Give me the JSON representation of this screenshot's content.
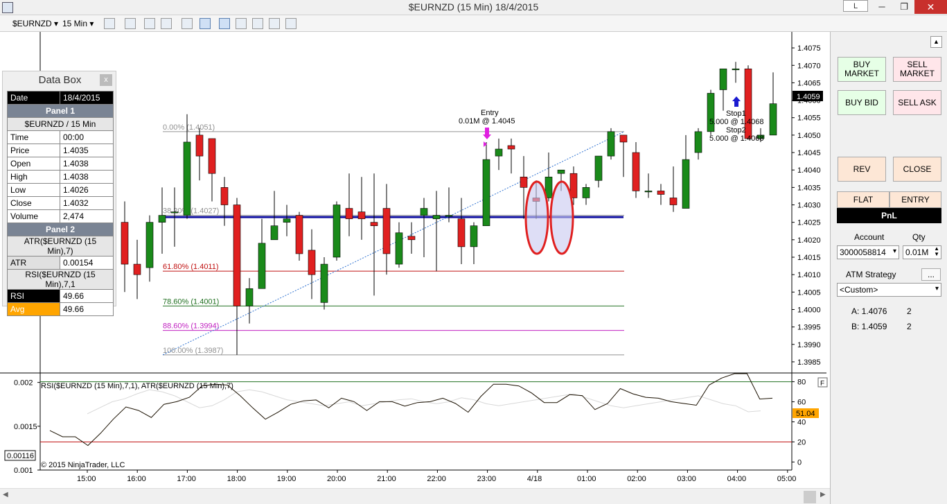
{
  "window": {
    "title": "$EURNZD (15 Min)  18/4/2015",
    "link_label": "L",
    "min_glyph": "─",
    "max_glyph": "❐",
    "close_glyph": "✕"
  },
  "toolbar": {
    "instrument": "$EURNZD",
    "interval": "15 Min",
    "dropdown_glyph": "▾"
  },
  "databox": {
    "title": "Data Box",
    "close_label": "x",
    "date_label": "Date",
    "date_value": "18/4/2015",
    "panel1_label": "Panel 1",
    "series_label": "$EURNZD / 15 Min",
    "rows": [
      {
        "k": "Time",
        "v": "00:00"
      },
      {
        "k": "Price",
        "v": "1.4035"
      },
      {
        "k": "Open",
        "v": "1.4038"
      },
      {
        "k": "High",
        "v": "1.4038"
      },
      {
        "k": "Low",
        "v": "1.4026"
      },
      {
        "k": "Close",
        "v": "1.4032"
      },
      {
        "k": "Volume",
        "v": "2,474"
      }
    ],
    "panel2_label": "Panel 2",
    "atr_series_label": "ATR($EURNZD (15 Min),7)",
    "atr_key": "ATR",
    "atr_value": "0.00154",
    "rsi_series_label": "RSI($EURNZD (15 Min),7,1",
    "rsi_key": "RSI",
    "rsi_value": "49.66",
    "avg_key": "Avg",
    "avg_value": "49.66"
  },
  "chart": {
    "indicator_label": "RSI($EURNZD (15 Min),7,1), ATR($EURNZD (15 Min),7)",
    "copyright": "© 2015 NinjaTrader, LLC",
    "price_tag": "1.4059",
    "rsi_tag": "51.04",
    "atr_tag": "0.00116",
    "f_button": "F",
    "entry_label": "Entry",
    "entry_detail": "0.01M @ 1.4045",
    "stop1_label": "Stop1",
    "stop1_detail": "5.000 @ 1.4068",
    "stop2_label": "Stop2",
    "stop2_detail": "5.000 @ 1.4068",
    "colors": {
      "up": "#1a8a1a",
      "down": "#e02020",
      "blue_line": "#1010a0",
      "ellipse": "#e02020",
      "ellipse_fill": "#c8c8f0"
    },
    "fib_levels": [
      {
        "label": "0.00% (1.4051)",
        "price": 1.4051,
        "color": "#909090"
      },
      {
        "label": "38.20% (1.4027)",
        "price": 1.4027,
        "color": "#909090"
      },
      {
        "label": "61.80% (1.4011)",
        "price": 1.4011,
        "color": "#c01010"
      },
      {
        "label": "78.60% (1.4001)",
        "price": 1.4001,
        "color": "#207020"
      },
      {
        "label": "88.60% (1.3994)",
        "price": 1.3994,
        "color": "#c020c0"
      },
      {
        "label": "100.00% (1.3987)",
        "price": 1.3987,
        "color": "#909090"
      }
    ]
  },
  "chart_data": {
    "type": "candlestick",
    "price_axis": {
      "ticks": [
        "1.4075",
        "1.4070",
        "1.4065",
        "1.4060",
        "1.4055",
        "1.4050",
        "1.4045",
        "1.4040",
        "1.4035",
        "1.4030",
        "1.4025",
        "1.4020",
        "1.4015",
        "1.4010",
        "1.4005",
        "1.4000",
        "1.3995",
        "1.3990",
        "1.3985"
      ],
      "range": [
        1.3983,
        1.4078
      ]
    },
    "time_axis": {
      "ticks": [
        "15:00",
        "16:00",
        "17:00",
        "18:00",
        "19:00",
        "20:00",
        "21:00",
        "22:00",
        "23:00",
        "4/18",
        "01:00",
        "02:00",
        "03:00",
        "04:00",
        "05:00"
      ]
    },
    "rsi_axis": {
      "ticks": [
        "80",
        "60",
        "40",
        "20",
        "0"
      ],
      "range": [
        -8,
        88
      ]
    },
    "atr_axis": {
      "ticks": [
        "0.002",
        "0.0015",
        "0.001"
      ],
      "range": [
        0.001,
        0.0021
      ]
    },
    "candles": [
      {
        "o": 1.4032,
        "h": 1.4034,
        "l": 1.4001,
        "c": 1.4004
      },
      {
        "o": 1.4008,
        "h": 1.4011,
        "l": 1.4001,
        "c": 1.4007
      },
      {
        "o": 1.4023,
        "h": 1.403,
        "l": 1.4001,
        "c": 1.403
      },
      {
        "o": 1.4025,
        "h": 1.4031,
        "l": 1.4005,
        "c": 1.4013
      },
      {
        "o": 1.4013,
        "h": 1.402,
        "l": 1.4003,
        "c": 1.401
      },
      {
        "o": 1.4012,
        "h": 1.4027,
        "l": 1.4008,
        "c": 1.4025
      },
      {
        "o": 1.4025,
        "h": 1.4035,
        "l": 1.4016,
        "c": 1.4027
      },
      {
        "o": 1.4028,
        "h": 1.4035,
        "l": 1.4018,
        "c": 1.4028
      },
      {
        "o": 1.4027,
        "h": 1.4056,
        "l": 1.4026,
        "c": 1.4048
      },
      {
        "o": 1.405,
        "h": 1.4052,
        "l": 1.4037,
        "c": 1.4044
      },
      {
        "o": 1.4049,
        "h": 1.4049,
        "l": 1.4031,
        "c": 1.4039
      },
      {
        "o": 1.4035,
        "h": 1.4038,
        "l": 1.4024,
        "c": 1.403
      },
      {
        "o": 1.403,
        "h": 1.4032,
        "l": 1.3987,
        "c": 1.4001
      },
      {
        "o": 1.4001,
        "h": 1.4009,
        "l": 1.3996,
        "c": 1.4006
      },
      {
        "o": 1.4006,
        "h": 1.4026,
        "l": 1.4006,
        "c": 1.4019
      },
      {
        "o": 1.402,
        "h": 1.4034,
        "l": 1.402,
        "c": 1.4024
      },
      {
        "o": 1.4025,
        "h": 1.403,
        "l": 1.4021,
        "c": 1.4026
      },
      {
        "o": 1.4027,
        "h": 1.4028,
        "l": 1.4014,
        "c": 1.4016
      },
      {
        "o": 1.4017,
        "h": 1.4023,
        "l": 1.4003,
        "c": 1.401
      },
      {
        "o": 1.4002,
        "h": 1.4015,
        "l": 1.4,
        "c": 1.4013
      },
      {
        "o": 1.4015,
        "h": 1.4031,
        "l": 1.4014,
        "c": 1.403
      },
      {
        "o": 1.4029,
        "h": 1.4039,
        "l": 1.4021,
        "c": 1.4026
      },
      {
        "o": 1.4028,
        "h": 1.4038,
        "l": 1.402,
        "c": 1.4026
      },
      {
        "o": 1.4025,
        "h": 1.4039,
        "l": 1.4004,
        "c": 1.4024
      },
      {
        "o": 1.4029,
        "h": 1.4036,
        "l": 1.401,
        "c": 1.4016
      },
      {
        "o": 1.4013,
        "h": 1.4025,
        "l": 1.4012,
        "c": 1.4022
      },
      {
        "o": 1.4021,
        "h": 1.4025,
        "l": 1.4016,
        "c": 1.402
      },
      {
        "o": 1.4027,
        "h": 1.4032,
        "l": 1.4015,
        "c": 1.4029
      },
      {
        "o": 1.4026,
        "h": 1.4034,
        "l": 1.4011,
        "c": 1.4027
      },
      {
        "o": 1.4027,
        "h": 1.4035,
        "l": 1.4025,
        "c": 1.4027
      },
      {
        "o": 1.4026,
        "h": 1.4032,
        "l": 1.4013,
        "c": 1.4018
      },
      {
        "o": 1.4018,
        "h": 1.4025,
        "l": 1.4013,
        "c": 1.4024
      },
      {
        "o": 1.4024,
        "h": 1.4048,
        "l": 1.4024,
        "c": 1.4043
      },
      {
        "o": 1.4044,
        "h": 1.4049,
        "l": 1.404,
        "c": 1.4046
      },
      {
        "o": 1.4047,
        "h": 1.4049,
        "l": 1.4039,
        "c": 1.4046
      },
      {
        "o": 1.4038,
        "h": 1.4044,
        "l": 1.4026,
        "c": 1.4035
      },
      {
        "o": 1.4032,
        "h": 1.4037,
        "l": 1.4026,
        "c": 1.4031
      },
      {
        "o": 1.4032,
        "h": 1.4045,
        "l": 1.4031,
        "c": 1.4038
      },
      {
        "o": 1.4039,
        "h": 1.404,
        "l": 1.4034,
        "c": 1.404
      },
      {
        "o": 1.4039,
        "h": 1.4041,
        "l": 1.403,
        "c": 1.4032
      },
      {
        "o": 1.4032,
        "h": 1.4036,
        "l": 1.403,
        "c": 1.4035
      },
      {
        "o": 1.4037,
        "h": 1.4044,
        "l": 1.4035,
        "c": 1.4044
      },
      {
        "o": 1.4044,
        "h": 1.4052,
        "l": 1.4043,
        "c": 1.4051
      },
      {
        "o": 1.405,
        "h": 1.405,
        "l": 1.4038,
        "c": 1.4048
      },
      {
        "o": 1.4045,
        "h": 1.4048,
        "l": 1.4032,
        "c": 1.4034
      },
      {
        "o": 1.4034,
        "h": 1.4039,
        "l": 1.4032,
        "c": 1.4034
      },
      {
        "o": 1.4034,
        "h": 1.4036,
        "l": 1.403,
        "c": 1.4033
      },
      {
        "o": 1.4032,
        "h": 1.4041,
        "l": 1.4028,
        "c": 1.403
      },
      {
        "o": 1.4029,
        "h": 1.405,
        "l": 1.4029,
        "c": 1.4043
      },
      {
        "o": 1.4045,
        "h": 1.4052,
        "l": 1.4043,
        "c": 1.4051
      },
      {
        "o": 1.4051,
        "h": 1.4063,
        "l": 1.405,
        "c": 1.4062
      },
      {
        "o": 1.4063,
        "h": 1.4069,
        "l": 1.4057,
        "c": 1.4069
      },
      {
        "o": 1.4069,
        "h": 1.4071,
        "l": 1.4065,
        "c": 1.4069
      },
      {
        "o": 1.4069,
        "h": 1.407,
        "l": 1.4049,
        "c": 1.4049
      },
      {
        "o": 1.4049,
        "h": 1.4052,
        "l": 1.4048,
        "c": 1.405
      },
      {
        "o": 1.405,
        "h": 1.4068,
        "l": 1.405,
        "c": 1.4059
      }
    ],
    "rsi": [
      48,
      54,
      60,
      63,
      68,
      72,
      70,
      66,
      60,
      54,
      56,
      62,
      70,
      72,
      70,
      66,
      62,
      60,
      58,
      56,
      58,
      60,
      56,
      58,
      60,
      62,
      63,
      60,
      58,
      60,
      64,
      62,
      58,
      56,
      58,
      60,
      62,
      64,
      66,
      68,
      64,
      60,
      56,
      54,
      56,
      58,
      60,
      62,
      64,
      66,
      62,
      58,
      56,
      50,
      51
    ],
    "atr": [
      0.00145,
      0.00138,
      0.00138,
      0.00128,
      0.00142,
      0.00158,
      0.00172,
      0.00168,
      0.0016,
      0.00175,
      0.00178,
      0.00183,
      0.00196,
      0.00198,
      0.00197,
      0.00185,
      0.00171,
      0.00158,
      0.00166,
      0.00175,
      0.00179,
      0.0018,
      0.00171,
      0.00182,
      0.00178,
      0.00168,
      0.00178,
      0.00178,
      0.00173,
      0.00177,
      0.00178,
      0.00182,
      0.00176,
      0.00166,
      0.00184,
      0.00198,
      0.00198,
      0.00196,
      0.00188,
      0.00177,
      0.00177,
      0.00186,
      0.00185,
      0.00169,
      0.00176,
      0.00193,
      0.00187,
      0.00183,
      0.00182,
      0.00178,
      0.00176,
      0.00174,
      0.00197,
      0.00205,
      0.0021,
      0.0021,
      0.00181,
      0.00182
    ]
  },
  "rightpanel": {
    "collapse_glyph": "▲",
    "buy_market": "BUY MARKET",
    "sell_market": "SELL MARKET",
    "buy_bid": "BUY BID",
    "sell_ask": "SELL ASK",
    "rev": "REV",
    "close": "CLOSE",
    "flat": "FLAT",
    "entry": "ENTRY",
    "pnl": "PnL",
    "account_label": "Account",
    "qty_label": "Qty",
    "account_value": "3000058814",
    "qty_value": "0.01M",
    "atm_label": "ATM Strategy",
    "atm_more": "...",
    "atm_value": "<Custom>",
    "a_label": "A: 1.4076",
    "a_qty": "2",
    "b_label": "B: 1.4059",
    "b_qty": "2"
  }
}
